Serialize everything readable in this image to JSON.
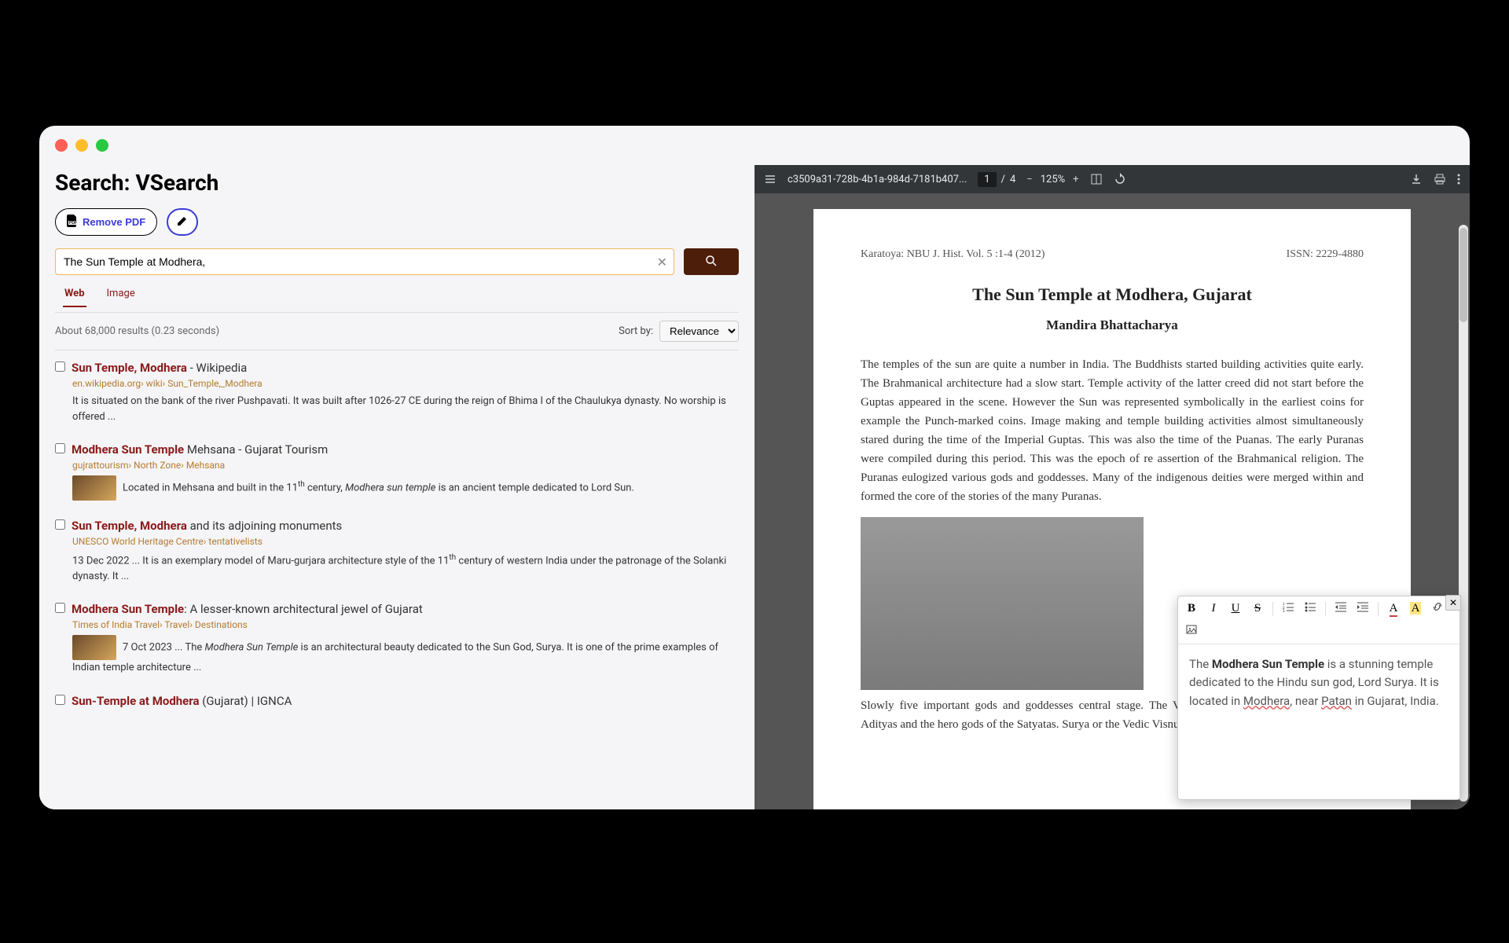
{
  "page_title": "Search: VSearch",
  "buttons": {
    "remove_pdf": "Remove PDF"
  },
  "search": {
    "query": "The Sun Temple at Modhera,",
    "tabs": {
      "web": "Web",
      "image": "Image"
    },
    "result_count": "About 68,000 results (0.23 seconds)",
    "sort_label": "Sort by:",
    "sort_value": "Relevance"
  },
  "results": [
    {
      "title_pre": "Sun Temple, Modhera",
      "title_post": " - Wikipedia",
      "url": "en.wikipedia.org› wiki› Sun_Temple,_Modhera",
      "snippet": "It is situated on the bank of the river Pushpavati. It was built after 1026-27 CE during the reign of Bhima I of the Chaulukya dynasty. No worship is offered ...",
      "has_thumb": false
    },
    {
      "title_pre": "Modhera Sun Temple",
      "title_post": " Mehsana - Gujarat Tourism",
      "url": "gujrattourism› North Zone› Mehsana",
      "snippet": "Located in Mehsana and built in the 11th century, Modhera sun temple is an ancient temple dedicated to Lord Sun.",
      "has_thumb": true
    },
    {
      "title_pre": "Sun Temple, Modhera",
      "title_post": " and its adjoining monuments",
      "url": "UNESCO World Heritage Centre› tentativelists",
      "snippet": "13 Dec 2022 ... It is an exemplary model of Maru-gurjara architecture style of the 11th century of western India under the patronage of the Solanki dynasty. It ...",
      "has_thumb": false
    },
    {
      "title_pre": "Modhera Sun Temple",
      "title_post": ": A lesser-known architectural jewel of Gujarat",
      "url": "Times of India Travel› Travel› Destinations",
      "snippet": "7 Oct 2023 ... The Modhera Sun Temple is an architectural beauty dedicated to the Sun God, Surya. It is one of the prime examples of Indian temple architecture ...",
      "has_thumb": true
    },
    {
      "title_pre": "Sun-Temple at Modhera",
      "title_post": " (Gujarat) | IGNCA",
      "url": "",
      "snippet": "",
      "has_thumb": false
    }
  ],
  "pdf": {
    "filename": "c3509a31-728b-4b1a-984d-7181b407...",
    "current_page": "1",
    "total_pages": "4",
    "page_sep": "/",
    "zoom": "125%",
    "journal_left": "Karatoya: NBU  J. Hist. Vol. 5 :1-4 (2012)",
    "journal_right": "ISSN: 2229-4880",
    "title": "The Sun Temple at Modhera, Gujarat",
    "author": "Mandira Bhattacharya",
    "para1": "The temples of the sun are quite a number in India. The Buddhists started building activities quite early. The Brahmanical architecture had a slow start. Temple activity of the latter creed did not start before the Guptas appeared in the scene. However the Sun was represented symbolically in the earliest coins for example the Punch-marked coins. Image making and temple building activities almost simultaneously stared during the time of the Imperial Guptas. This was also the time of the Puanas. The early Puranas were compiled during this period. This was the epoch of re assertion of the Brahmanical religion. The Puranas eulogized various gods and goddesses. Many of the indigenous deities were merged within and formed the core of the stories of the many Puranas.",
    "para2": "Slowly five important gods and goddesses central stage. The Vedic god Rudra was transformed the Adityas and the hero gods of the Satyatas. Surya or the Vedic Visnu combined within"
  },
  "editor": {
    "text_pre": "The ",
    "text_bold": "Modhera Sun Temple",
    "text_mid": " is a stunning temple dedicated to the Hindu sun god, Lord Surya. It is located in ",
    "wavy1": "Modhera",
    "text_mid2": ", near ",
    "wavy2": "Patan",
    "text_post": " in Gujarat, India."
  }
}
